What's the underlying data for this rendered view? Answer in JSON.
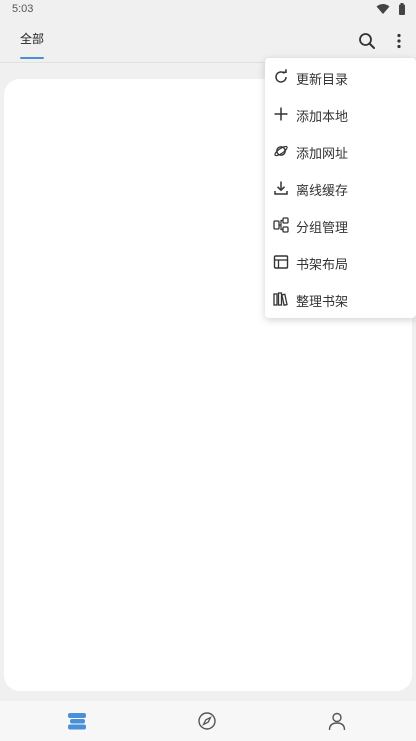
{
  "status_bar": {
    "time": "5:03"
  },
  "tabs": [
    {
      "label": "全部",
      "selected": true
    }
  ],
  "menu": {
    "items": [
      {
        "label": "更新目录",
        "icon": "refresh-icon"
      },
      {
        "label": "添加本地",
        "icon": "plus-icon"
      },
      {
        "label": "添加网址",
        "icon": "planet-icon"
      },
      {
        "label": "离线缓存",
        "icon": "download-icon"
      },
      {
        "label": "分组管理",
        "icon": "group-icon"
      },
      {
        "label": "书架布局",
        "icon": "layout-icon"
      },
      {
        "label": "整理书架",
        "icon": "books-icon"
      }
    ]
  },
  "bottom_nav": [
    {
      "icon": "bookshelf-icon",
      "active": true
    },
    {
      "icon": "compass-icon",
      "active": false
    },
    {
      "icon": "person-icon",
      "active": false
    }
  ],
  "colors": {
    "accent": "#4a90d9",
    "background": "#f0f0f0",
    "card": "#ffffff"
  }
}
